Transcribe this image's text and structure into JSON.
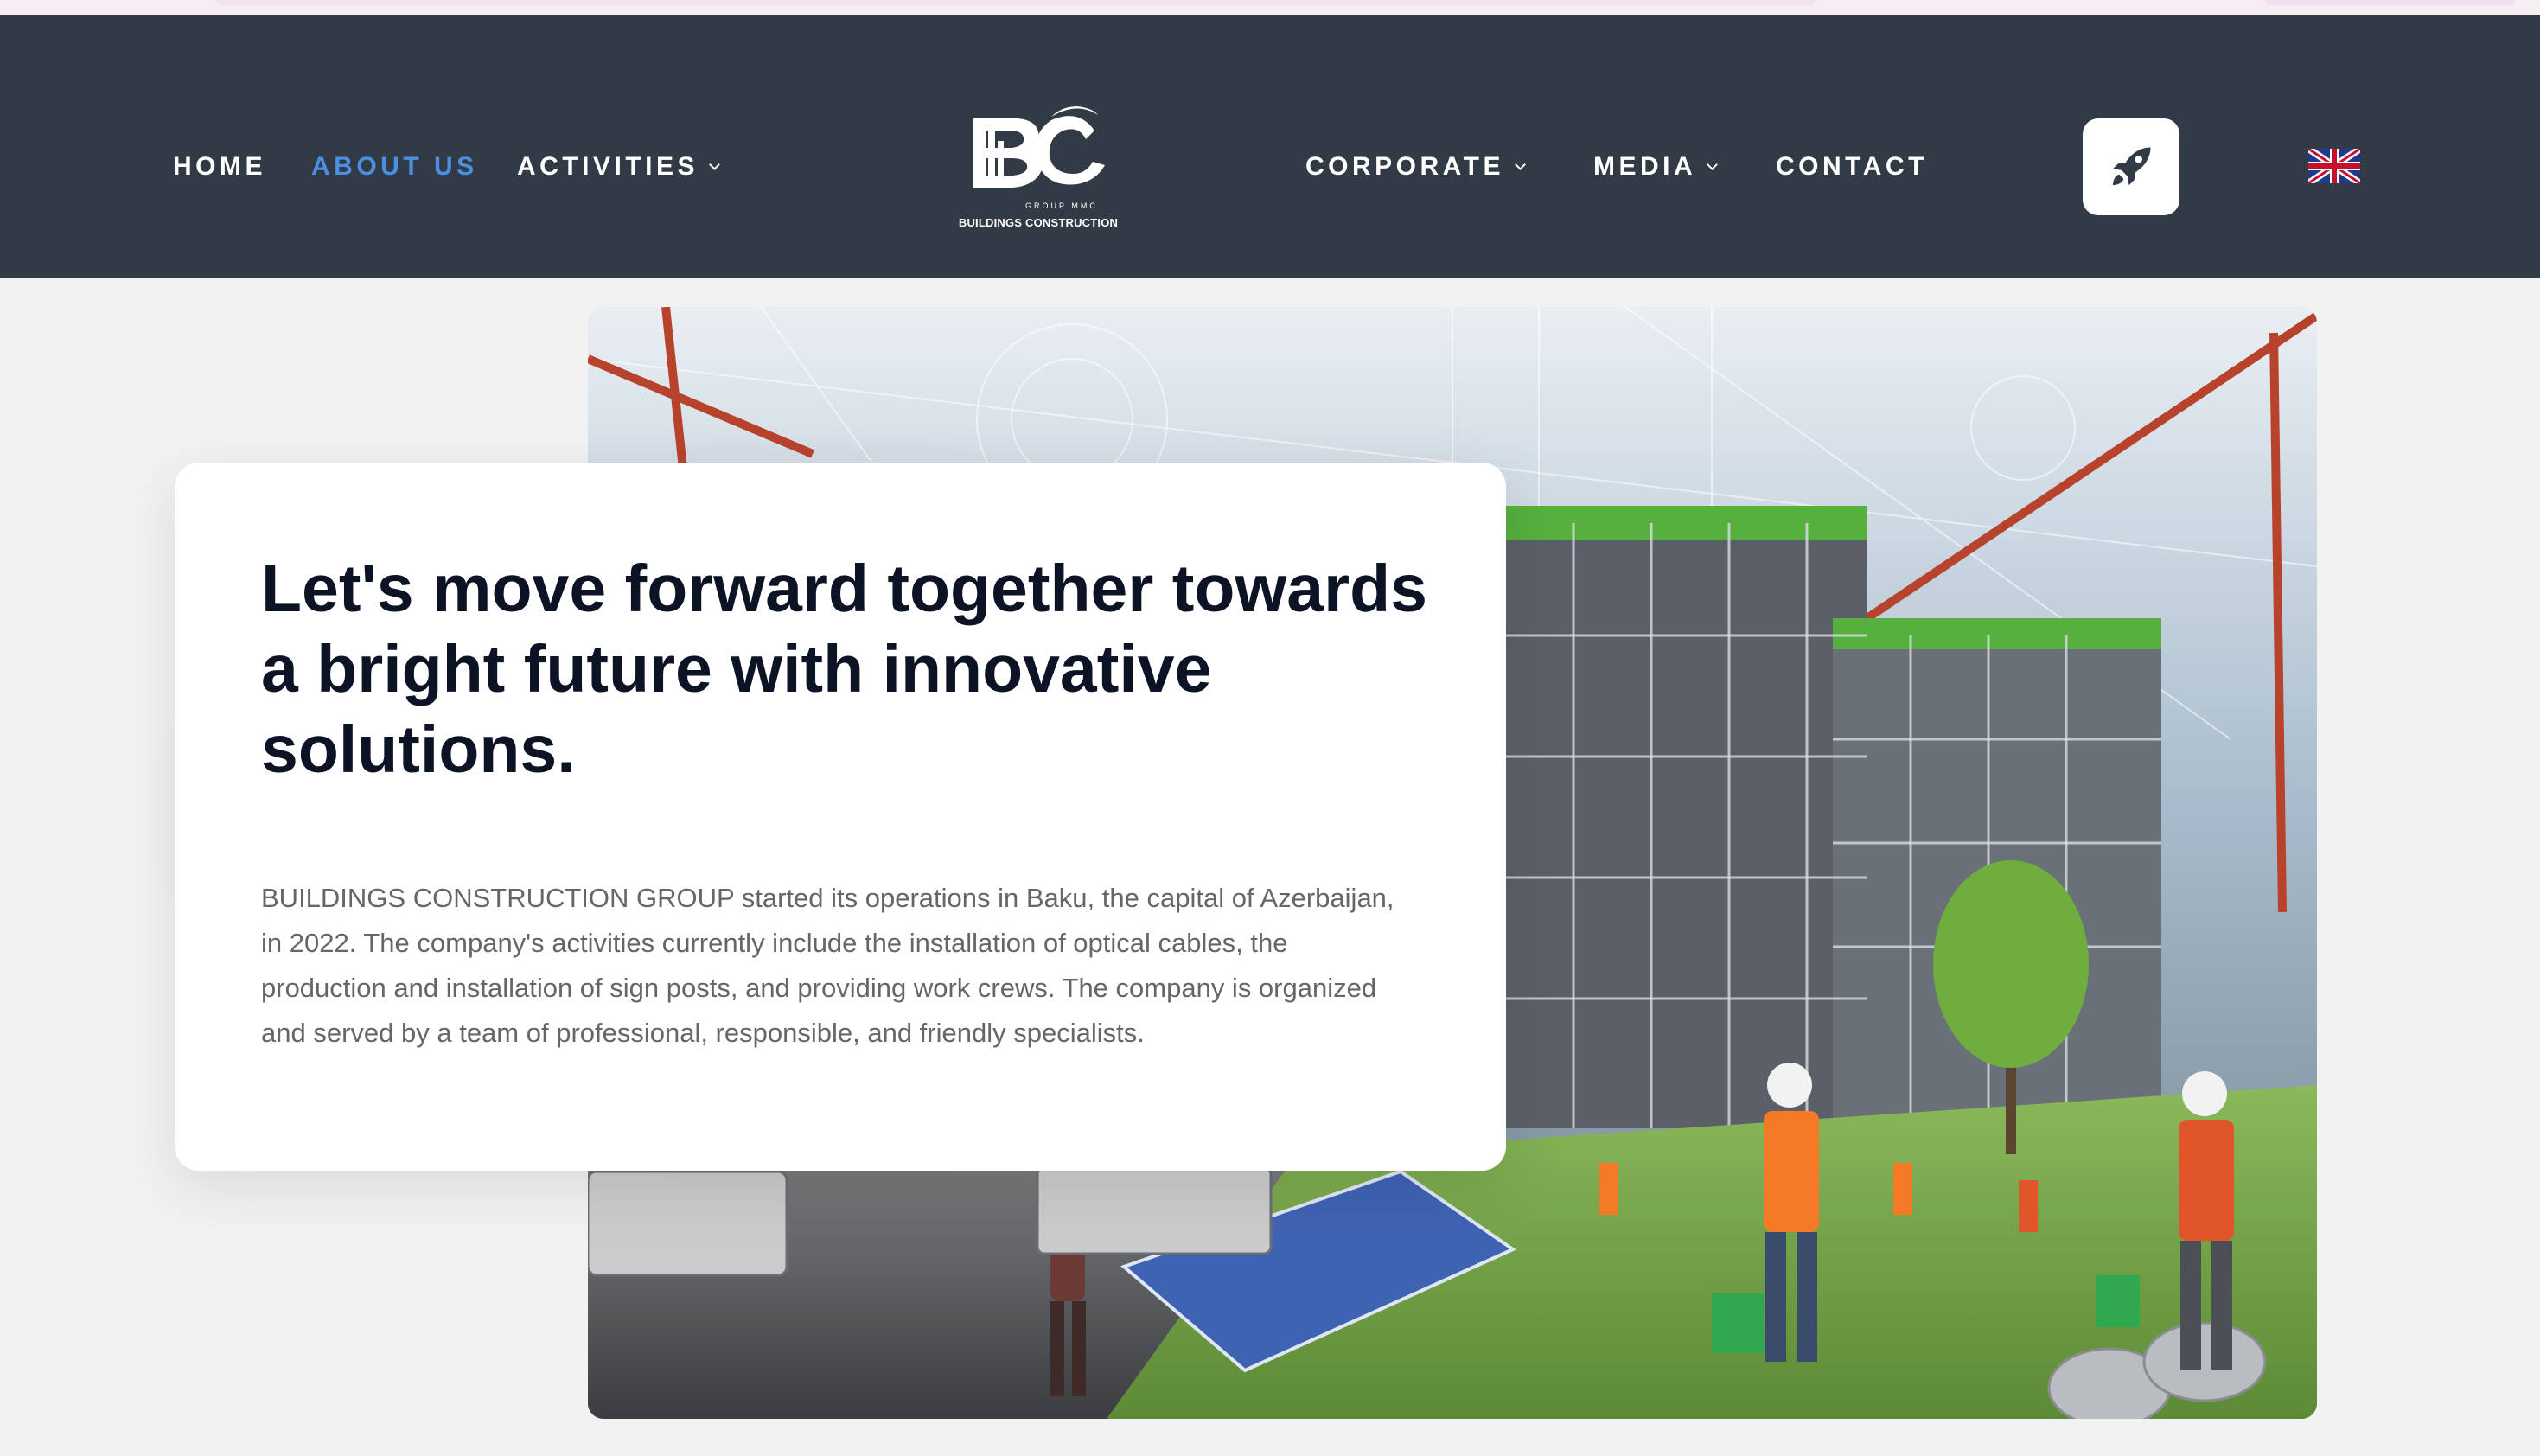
{
  "nav": {
    "left": [
      {
        "label": "HOME",
        "active": false,
        "dropdown": false
      },
      {
        "label": "ABOUT US",
        "active": true,
        "dropdown": false
      },
      {
        "label": "ACTIVITIES",
        "active": false,
        "dropdown": true
      }
    ],
    "right": [
      {
        "label": "CORPORATE",
        "active": false,
        "dropdown": true
      },
      {
        "label": "MEDIA",
        "active": false,
        "dropdown": true
      },
      {
        "label": "CONTACT",
        "active": false,
        "dropdown": false
      }
    ],
    "active_color": "#4a90e2",
    "background_color": "#323a45"
  },
  "logo": {
    "monogram": "BC",
    "group_text": "GROUP MMC",
    "company_text": "BUILDINGS CONSTRUCTION"
  },
  "actions": {
    "rocket_icon": "rocket-icon",
    "language_flag": "uk-flag-icon"
  },
  "hero": {
    "headline": "Let's move forward together towards a bright future with innovative solutions.",
    "paragraph": "BUILDINGS CONSTRUCTION GROUP started its operations in Baku, the capital of Azerbaijan, in 2022. The company's activities currently include the installation of optical cables, the production and installation of sign posts, and providing work crews. The company is organized and served by a team of professional, responsible, and friendly specialists.",
    "image_subject": "construction site illustration with cranes, scaffolded building, solar panel and workers in hard hats"
  }
}
